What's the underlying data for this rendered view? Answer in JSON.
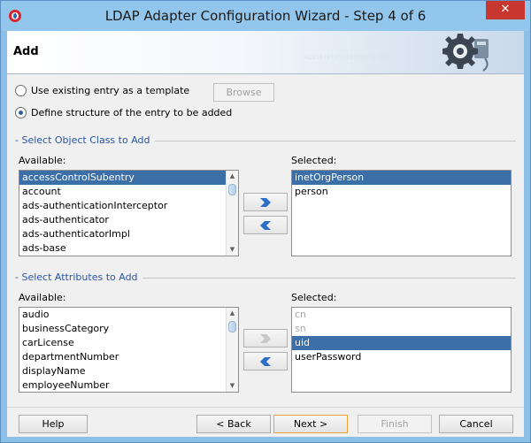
{
  "window": {
    "title": "LDAP Adapter Configuration Wizard - Step 4 of 6",
    "close_label": "✕"
  },
  "header": {
    "title": "Add",
    "binary": "01010101010101010101001"
  },
  "options": {
    "use_existing": "Use existing entry as a template",
    "browse": "Browse",
    "define_structure": "Define structure of the entry to be added"
  },
  "object_class": {
    "section": "Select Object Class to Add",
    "available_label": "Available:",
    "selected_label": "Selected:",
    "available": [
      "accessControlSubentry",
      "account",
      "ads-authenticationInterceptor",
      "ads-authenticator",
      "ads-authenticatorImpl",
      "ads-base"
    ],
    "available_selected": "accessControlSubentry",
    "selected": [
      "inetOrgPerson",
      "person"
    ],
    "selected_selected": "inetOrgPerson"
  },
  "attributes": {
    "section": "Select Attributes to Add",
    "available_label": "Available:",
    "selected_label": "Selected:",
    "available": [
      "audio",
      "businessCategory",
      "carLicense",
      "departmentNumber",
      "displayName",
      "employeeNumber"
    ],
    "selected": [
      "cn",
      "sn",
      "uid",
      "userPassword"
    ],
    "selected_dim": [
      "cn",
      "sn"
    ],
    "selected_selected": "uid"
  },
  "footer": {
    "help": "Help",
    "back": "< Back",
    "next": "Next >",
    "finish": "Finish",
    "cancel": "Cancel"
  },
  "icons": {
    "app": "oracle-icon",
    "wizard": "gear-icon",
    "move_right": "double-chevron-right-icon",
    "move_left": "double-chevron-left-icon"
  },
  "colors": {
    "selection": "#3c6fa8",
    "section_text": "#2a56a6",
    "title_bar": "#92c6ec",
    "close": "#c7372f"
  }
}
